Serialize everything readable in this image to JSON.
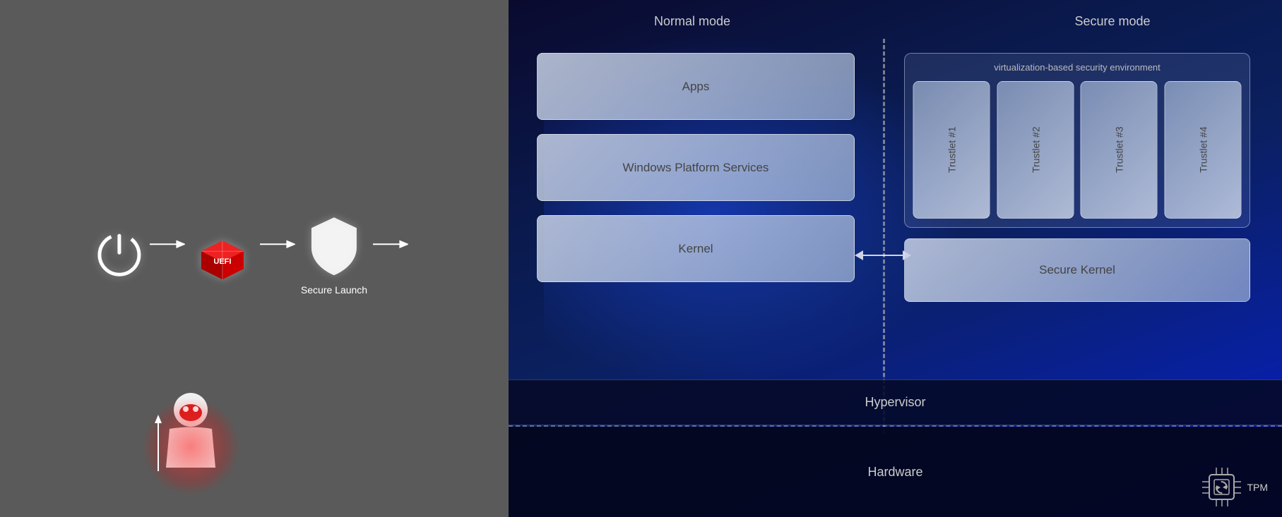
{
  "left_panel": {
    "flow": {
      "power_label": "",
      "uefi_label": "",
      "shield_label": "Secure Launch"
    },
    "attacker_label": ""
  },
  "right_panel": {
    "normal_mode_label": "Normal mode",
    "secure_mode_label": "Secure mode",
    "vbs_label": "virtualization-based security environment",
    "apps_label": "Apps",
    "wps_label": "Windows Platform Services",
    "kernel_label": "Kernel",
    "trustlets": [
      "Trustlet #1",
      "Trustlet #2",
      "Trustlet #3",
      "Trustlet #4"
    ],
    "secure_kernel_label": "Secure Kernel",
    "hypervisor_label": "Hypervisor",
    "hardware_label": "Hardware",
    "tpm_label": "TPM"
  }
}
